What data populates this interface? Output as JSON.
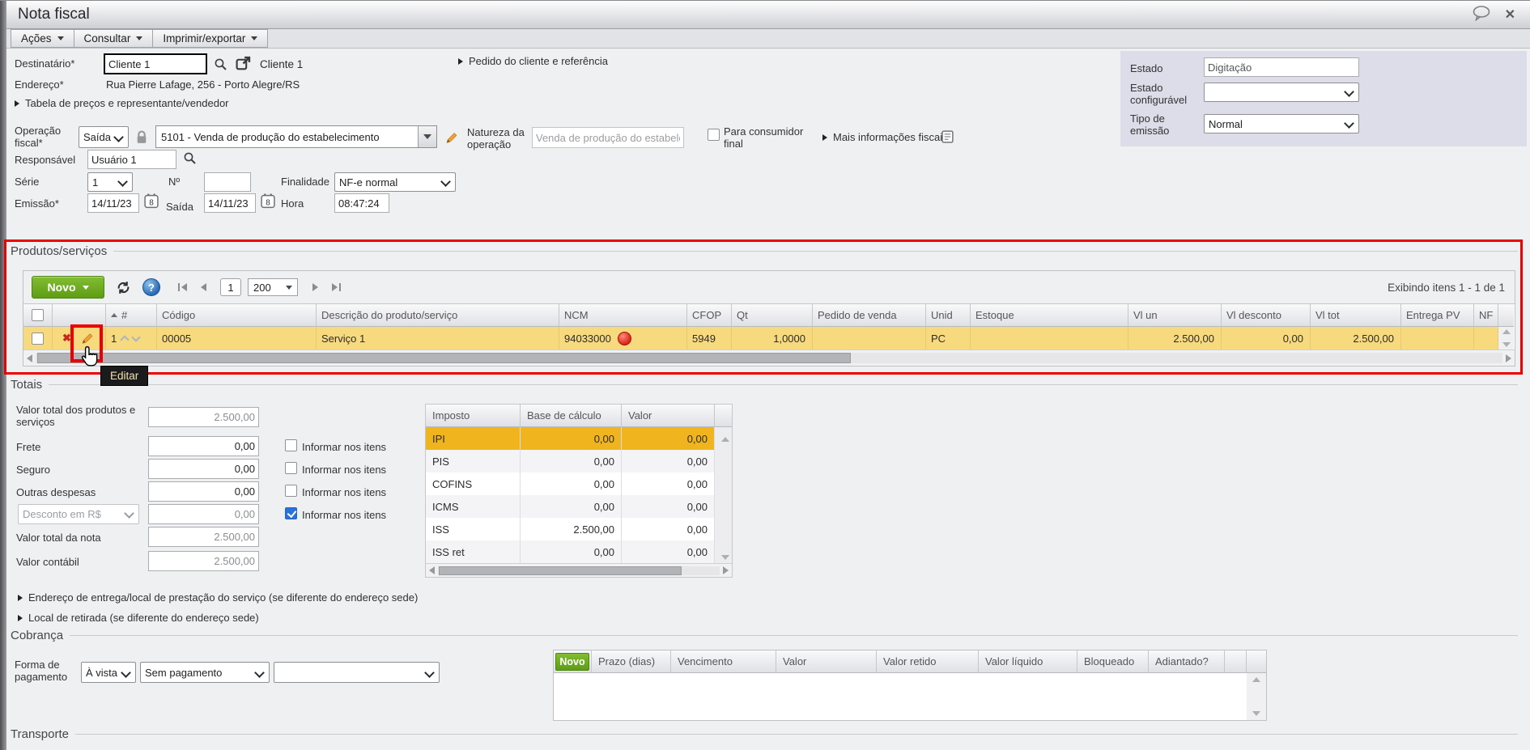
{
  "colors": {
    "accent_green": "#6fae1f",
    "selected_row": "#f7da7d",
    "selected_tax_row": "#f0b41e",
    "annotation_red": "#ec0000",
    "panel_lavender": "#dcdde9"
  },
  "titlebar": {
    "title": "Nota fiscal"
  },
  "menu": {
    "acoes": "Ações",
    "consultar": "Consultar",
    "imprimir": "Imprimir/exportar"
  },
  "header": {
    "destinatario_label": "Destinatário*",
    "destinatario_value": "Cliente 1",
    "destinatario_name": "Cliente 1",
    "pedido_link": "Pedido do cliente e referência",
    "endereco_label": "Endereço*",
    "endereco_value": "Rua Pierre Lafage, 256 - Porto Alegre/RS",
    "tabela_link": "Tabela de preços e representante/vendedor",
    "estado_label": "Estado",
    "estado_value": "Digitação",
    "estado_config_label": "Estado configurável",
    "tipo_emissao_label": "Tipo de emissão",
    "tipo_emissao_value": "Normal",
    "operacao_label": "Operação fiscal*",
    "operacao_tipo": "Saída",
    "operacao_value": "5101 - Venda de produção do estabelecimento",
    "natureza_label": "Natureza da operação",
    "natureza_value": "Venda de produção do estabelecime",
    "consumidor_label": "Para consumidor final",
    "maisinfo_link": "Mais informações fiscais",
    "responsavel_label": "Responsável",
    "responsavel_value": "Usuário 1",
    "serie_label": "Série",
    "serie_value": "1",
    "numero_label": "Nº",
    "finalidade_label": "Finalidade",
    "finalidade_value": "NF-e normal",
    "emissao_label": "Emissão*",
    "emissao_value": "14/11/23",
    "saida_label": "Saída",
    "saida_value": "14/11/23",
    "hora_label": "Hora",
    "hora_value": "08:47:24"
  },
  "products": {
    "title": "Produtos/serviços",
    "new_label": "Novo",
    "page": "1",
    "page_size": "200",
    "showing": "Exibindo itens 1 - 1 de 1",
    "tooltip": "Editar",
    "col_num": "#",
    "col_codigo": "Código",
    "col_desc": "Descrição do produto/serviço",
    "col_ncm": "NCM",
    "col_cfop": "CFOP",
    "col_qt": "Qt",
    "col_pedido": "Pedido de venda",
    "col_unid": "Unid",
    "col_estoque": "Estoque",
    "col_vlun": "Vl un",
    "col_vldesc": "Vl desconto",
    "col_vltot": "Vl tot",
    "col_entrega": "Entrega PV",
    "col_nf": "NF",
    "row": {
      "num": "1",
      "codigo": "00005",
      "desc": "Serviço 1",
      "ncm": "94033000",
      "cfop": "5949",
      "qt": "1,0000",
      "pedido": "",
      "unid": "PC",
      "estoque": "",
      "vl_un": "2.500,00",
      "vl_desc": "0,00",
      "vl_tot": "2.500,00",
      "entrega": "",
      "nf": ""
    }
  },
  "totais": {
    "title": "Totais",
    "valor_produtos_label": "Valor total dos produtos e serviços",
    "valor_produtos": "2.500,00",
    "frete_label": "Frete",
    "frete": "0,00",
    "seguro_label": "Seguro",
    "seguro": "0,00",
    "outras_label": "Outras despesas",
    "outras": "0,00",
    "desconto_label": "Desconto em R$",
    "desconto": "0,00",
    "valor_nota_label": "Valor total da nota",
    "valor_nota": "2.500,00",
    "valor_contabil_label": "Valor contábil",
    "valor_contabil": "2.500,00",
    "informar_label": "Informar nos itens"
  },
  "impostos": {
    "col_imposto": "Imposto",
    "col_base": "Base de cálculo",
    "col_valor": "Valor",
    "rows": [
      [
        "IPI",
        "0,00",
        "0,00"
      ],
      [
        "PIS",
        "0,00",
        "0,00"
      ],
      [
        "COFINS",
        "0,00",
        "0,00"
      ],
      [
        "ICMS",
        "0,00",
        "0,00"
      ],
      [
        "ISS",
        "2.500,00",
        "0,00"
      ],
      [
        "ISS ret",
        "0,00",
        "0,00"
      ]
    ]
  },
  "links": {
    "entrega": "Endereço de entrega/local de prestação do serviço (se diferente do endereço sede)",
    "retirada": "Local de retirada (se diferente do endereço sede)"
  },
  "cobranca": {
    "title": "Cobrança",
    "forma_label": "Forma de pagamento",
    "vista": "À vista",
    "pagamento": "Sem pagamento",
    "new_label": "Novo",
    "col_prazo": "Prazo (dias)",
    "col_venc": "Vencimento",
    "col_valor": "Valor",
    "col_retido": "Valor retido",
    "col_liquido": "Valor líquido",
    "col_bloq": "Bloqueado",
    "col_adiant": "Adiantado?"
  },
  "transporte": {
    "title": "Transporte"
  }
}
